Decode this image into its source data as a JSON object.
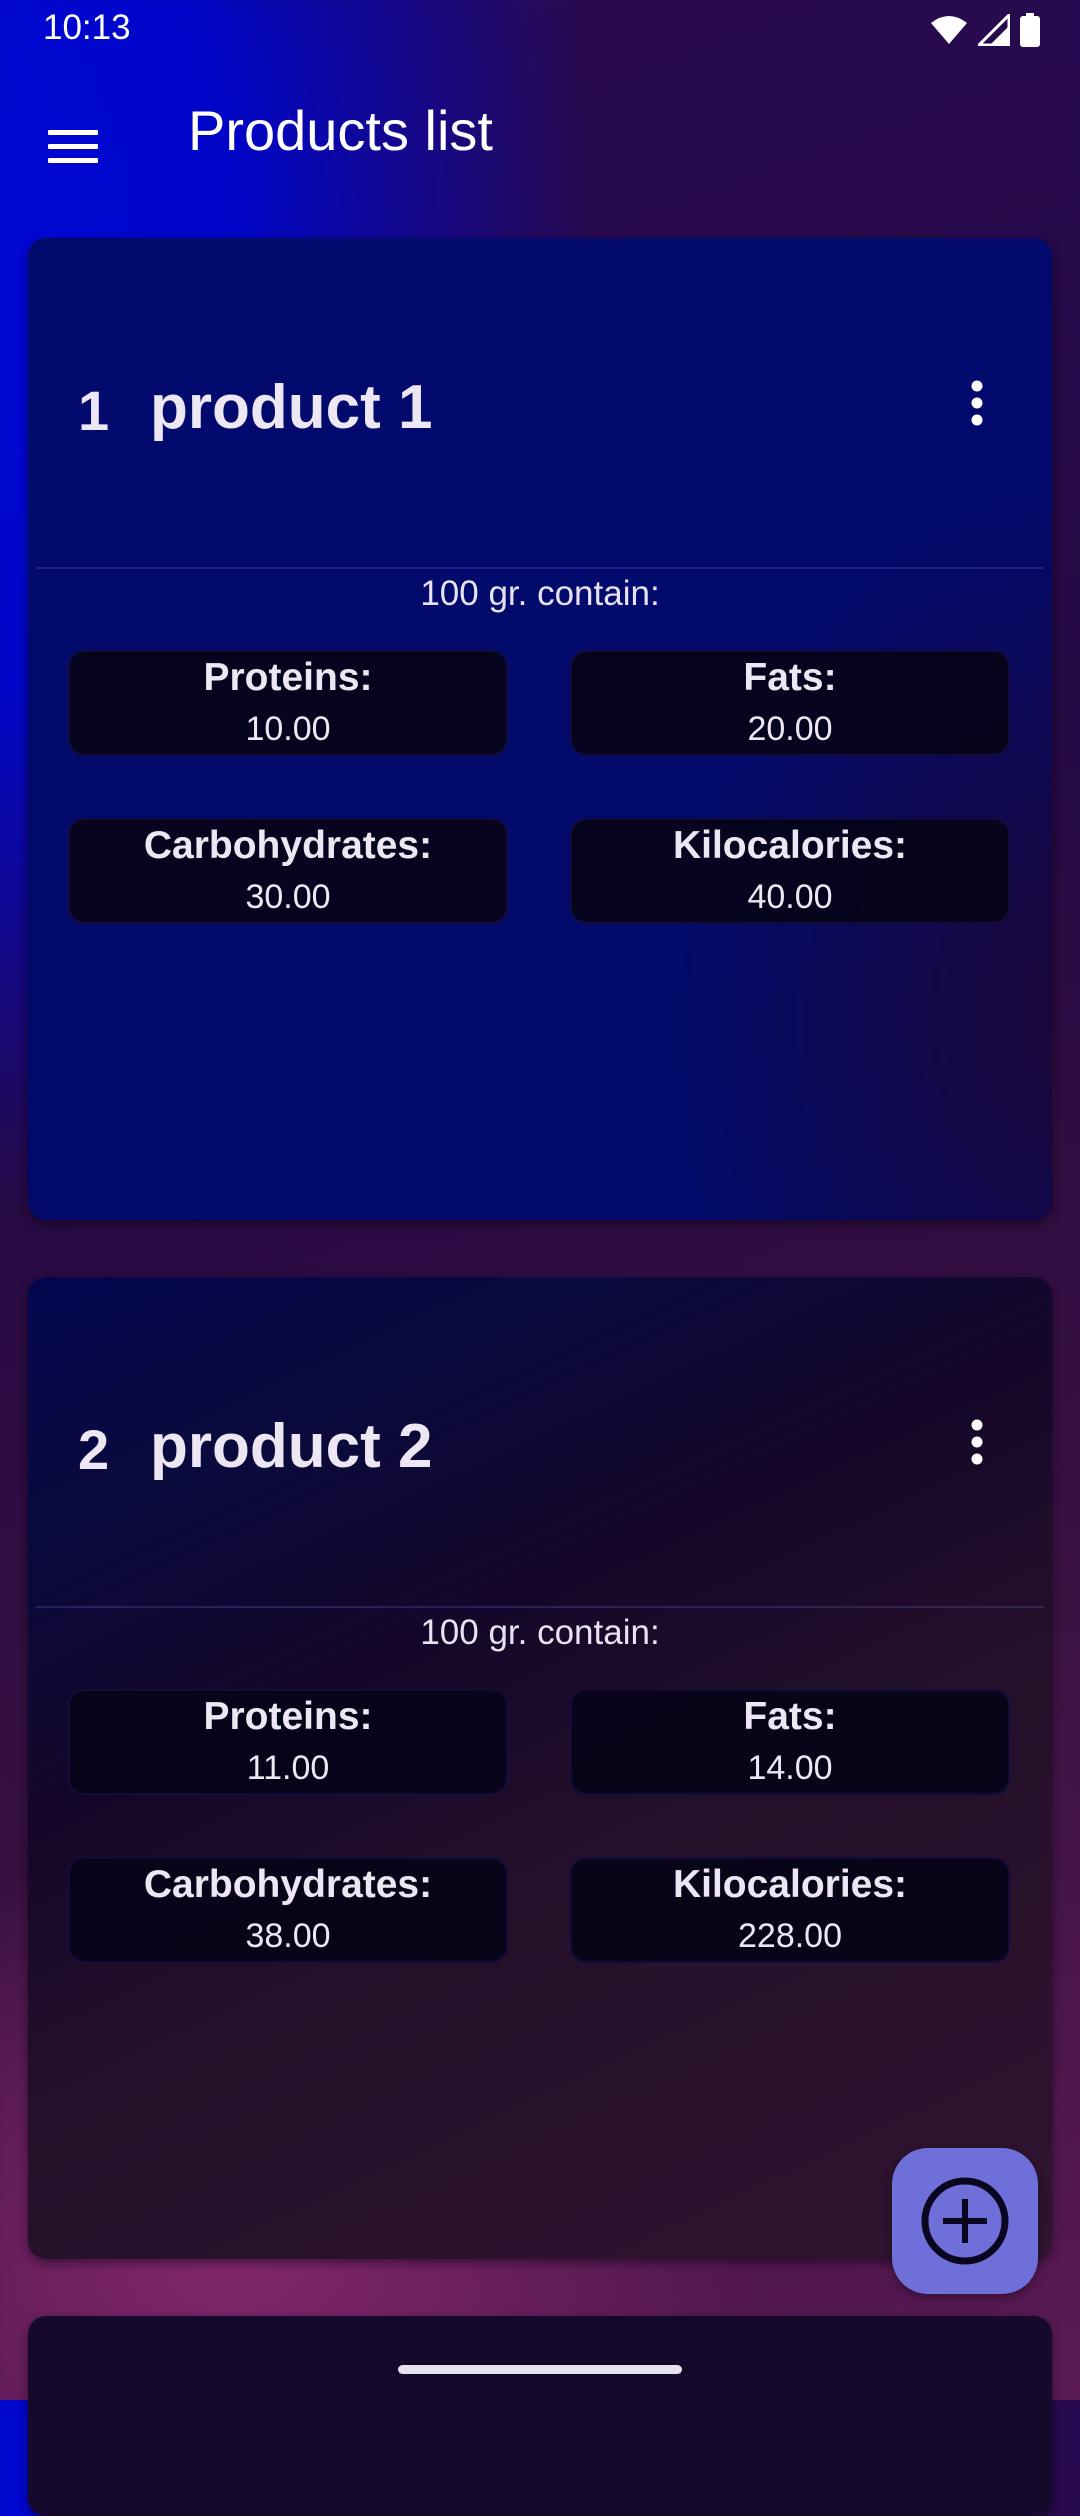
{
  "status_bar": {
    "time": "10:13",
    "icons": [
      "wifi-icon",
      "signal-icon",
      "battery-icon"
    ]
  },
  "app_bar": {
    "title": "Products list",
    "menu_icon": "menu-icon"
  },
  "products": [
    {
      "index": "1",
      "name": "product 1",
      "contain_label": "100 gr. contain:",
      "nutrients": [
        {
          "label": "Proteins:",
          "value": "10.00"
        },
        {
          "label": "Fats:",
          "value": "20.00"
        },
        {
          "label": "Carbohydrates:",
          "value": "30.00"
        },
        {
          "label": "Kilocalories:",
          "value": "40.00"
        }
      ]
    },
    {
      "index": "2",
      "name": "product 2",
      "contain_label": "100 gr. contain:",
      "nutrients": [
        {
          "label": "Proteins:",
          "value": "11.00"
        },
        {
          "label": "Fats:",
          "value": "14.00"
        },
        {
          "label": "Carbohydrates:",
          "value": "38.00"
        },
        {
          "label": "Kilocalories:",
          "value": "228.00"
        }
      ]
    }
  ],
  "fab": {
    "icon": "add-circle-icon"
  },
  "colors": {
    "accent": "#6f6fd9",
    "card_primary": "#010a6a",
    "background": "#2a0a55"
  }
}
